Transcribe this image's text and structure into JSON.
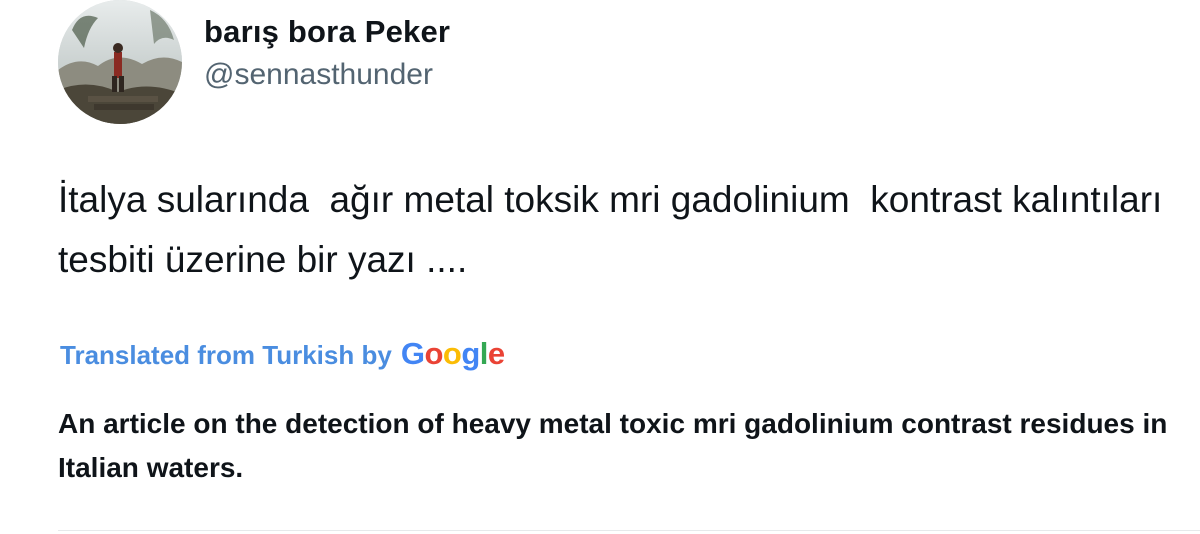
{
  "author": {
    "display_name": "barış bora Peker",
    "handle": "@sennasthunder"
  },
  "tweet": {
    "text": "İtalya sularında  ağır metal toksik mri gadolinium  kontrast kalıntıları tesbiti üzerine bir yazı ...."
  },
  "translation": {
    "label": "Translated from Turkish by",
    "provider_letters": [
      "G",
      "o",
      "o",
      "g",
      "l",
      "e"
    ],
    "provider_colors": [
      "#4285F4",
      "#EA4335",
      "#FBBC05",
      "#4285F4",
      "#34A853",
      "#EA4335"
    ],
    "text": "An article on the detection of heavy metal toxic mri gadolinium contrast residues in Italian waters."
  },
  "colors": {
    "text_primary": "#0f1419",
    "text_secondary": "#536471",
    "translate_link": "#4a8de0"
  }
}
